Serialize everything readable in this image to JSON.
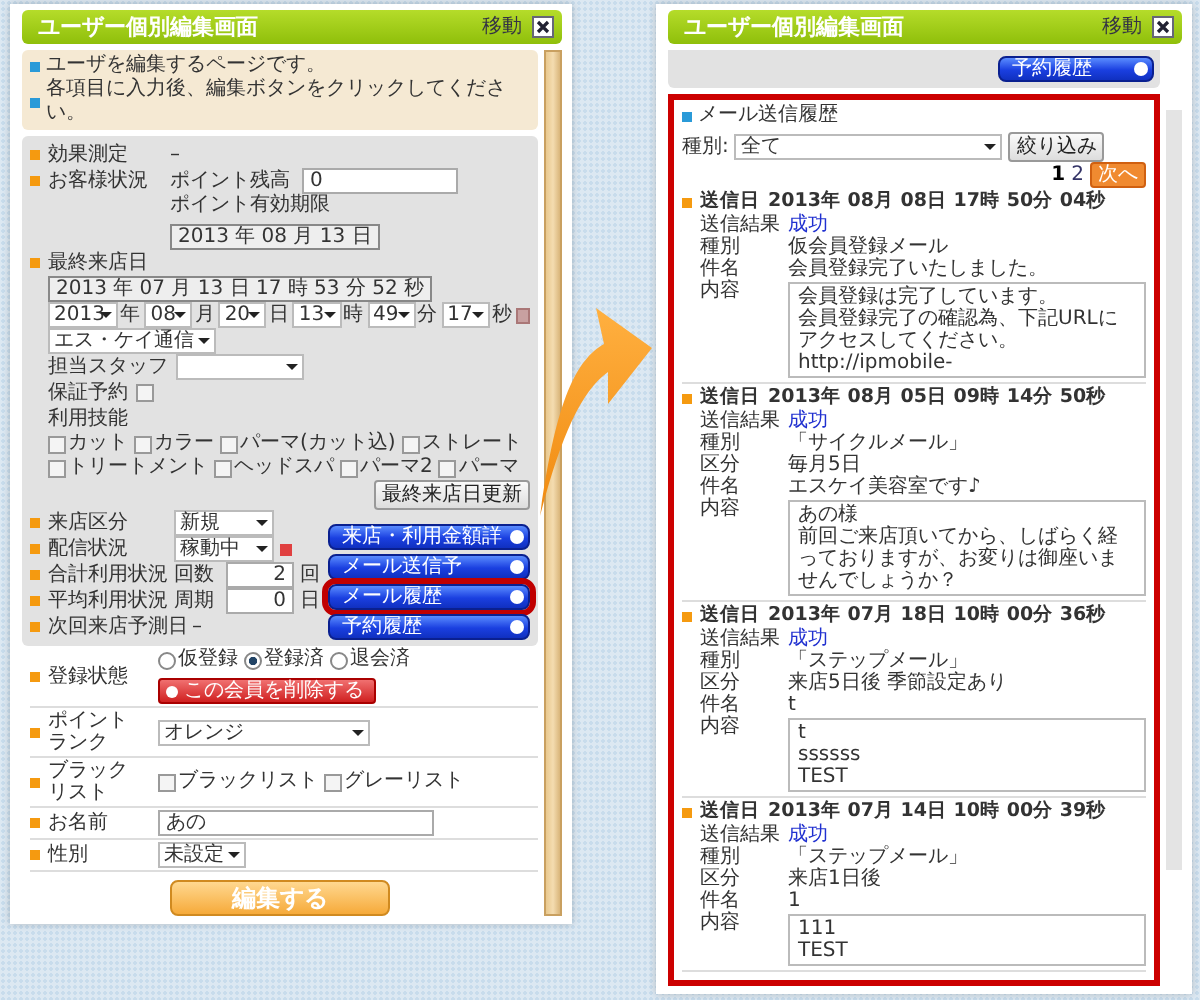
{
  "left_window": {
    "title": "ユーザー個別編集画面",
    "move_label": "移動",
    "notes": [
      "ユーザを編集するページです。",
      "各項目に入力後、編集ボタンをクリックしてください。"
    ],
    "effect": {
      "label": "効果測定",
      "value": "–"
    },
    "customer_status": {
      "label": "お客様状況",
      "points_label": "ポイント残高",
      "points_value": "0",
      "expiry_label": "ポイント有効期限",
      "expiry_value": "2013 年 08 月 13 日"
    },
    "last_visit": {
      "label": "最終来店日",
      "value": "2013 年 07 月 13 日 17 時 53 分 52 秒",
      "date_parts": [
        {
          "value": "2013",
          "unit": "年"
        },
        {
          "value": "08",
          "unit": "月"
        },
        {
          "value": "20",
          "unit": "日"
        },
        {
          "value": "13",
          "unit": "時"
        },
        {
          "value": "49",
          "unit": "分"
        },
        {
          "value": "17",
          "unit": "秒"
        }
      ],
      "store": "エス・ケイ通信",
      "staff_label": "担当スタッフ",
      "guarantee": {
        "label": "保証予約",
        "checked": false
      },
      "skills_label": "利用技能",
      "skills": [
        {
          "label": "カット",
          "checked": false
        },
        {
          "label": "カラー",
          "checked": false
        },
        {
          "label": "パーマ(カット込)",
          "checked": false
        },
        {
          "label": "ストレート",
          "checked": false
        },
        {
          "label": "トリートメント",
          "checked": false
        },
        {
          "label": "ヘッドスパ",
          "checked": false
        },
        {
          "label": "パーマ2",
          "checked": false
        },
        {
          "label": "パーマ",
          "checked": false
        }
      ],
      "update_button": "最終来店日更新"
    },
    "visit_type": {
      "label": "来店区分",
      "value": "新規"
    },
    "delivery": {
      "label": "配信状況",
      "value": "稼動中"
    },
    "total_usage": {
      "label": "合計利用状況",
      "field_label": "回数",
      "value": "2",
      "unit": "回"
    },
    "avg_usage": {
      "label": "平均利用状況",
      "field_label": "周期",
      "value": "0",
      "unit": "日"
    },
    "next_visit": {
      "label": "次回来店予測日",
      "value": "–"
    },
    "action_buttons": [
      {
        "label": "来店・利用金額詳",
        "highlighted": false
      },
      {
        "label": "メール送信予",
        "highlighted": false
      },
      {
        "label": "メール履歴",
        "highlighted": true
      },
      {
        "label": "予約履歴",
        "highlighted": false
      }
    ],
    "registration": {
      "label": "登録状態",
      "options": [
        {
          "label": "仮登録",
          "selected": false
        },
        {
          "label": "登録済",
          "selected": true
        },
        {
          "label": "退会済",
          "selected": false
        }
      ],
      "delete_button": "この会員を削除する"
    },
    "point_rank": {
      "label": "ポイントランク",
      "value": "オレンジ"
    },
    "blacklist": {
      "label": "ブラックリスト",
      "options": [
        {
          "label": "ブラックリスト",
          "checked": false
        },
        {
          "label": "グレーリスト",
          "checked": false
        }
      ]
    },
    "name": {
      "label": "お名前",
      "value": "あの"
    },
    "gender": {
      "label": "性別",
      "value": "未設定"
    },
    "submit_button": "編集する"
  },
  "right_window": {
    "title": "ユーザー個別編集画面",
    "move_label": "移動",
    "top_button": "予約履歴",
    "section_title": "メール送信履歴",
    "filter": {
      "label": "種別:",
      "value": "全て",
      "button": "絞り込み"
    },
    "pagination": {
      "pages": [
        {
          "label": "1",
          "selected": true
        },
        {
          "label": "2",
          "selected": false
        }
      ],
      "next": "次へ"
    },
    "entries": [
      {
        "date_label": "送信日",
        "date": "2013年 08月 08日 17時 50分 04秒",
        "result_label": "送信結果",
        "result": "成功",
        "fields": [
          {
            "label": "種別",
            "value": "仮会員登録メール"
          },
          {
            "label": "件名",
            "value": "会員登録完了いたしました。"
          }
        ],
        "content_label": "内容",
        "content": [
          "会員登録は完了しています。",
          "会員登録完了の確認為、下記URLにアクセスしてください。",
          "http://ipmobile-"
        ]
      },
      {
        "date_label": "送信日",
        "date": "2013年 08月 05日 09時 14分 50秒",
        "result_label": "送信結果",
        "result": "成功",
        "fields": [
          {
            "label": "種別",
            "value": "「サイクルメール」"
          },
          {
            "label": "区分",
            "value": "毎月5日"
          },
          {
            "label": "件名",
            "value": "エスケイ美容室です♪"
          }
        ],
        "content_label": "内容",
        "content": [
          "あの様",
          "前回ご来店頂いてから、しばらく経っておりますが、お変りは御座いませんでしょうか？"
        ]
      },
      {
        "date_label": "送信日",
        "date": "2013年 07月 18日 10時 00分 36秒",
        "result_label": "送信結果",
        "result": "成功",
        "fields": [
          {
            "label": "種別",
            "value": "「ステップメール」"
          },
          {
            "label": "区分",
            "value": "来店5日後 季節設定あり"
          },
          {
            "label": "件名",
            "value": "t"
          }
        ],
        "content_label": "内容",
        "content": [
          "t",
          "ssssss",
          "TEST"
        ]
      },
      {
        "date_label": "送信日",
        "date": "2013年 07月 14日 10時 00分 39秒",
        "result_label": "送信結果",
        "result": "成功",
        "fields": [
          {
            "label": "種別",
            "value": "「ステップメール」"
          },
          {
            "label": "区分",
            "value": "来店1日後"
          },
          {
            "label": "件名",
            "value": "1"
          }
        ],
        "content_label": "内容",
        "content": [
          "111",
          "TEST"
        ]
      }
    ]
  }
}
